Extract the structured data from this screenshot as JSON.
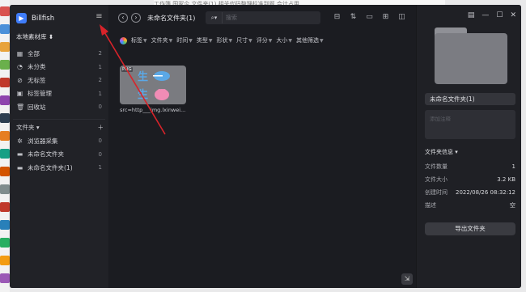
{
  "outer": {
    "top_text": "工作簿  国家企  文件夹(1)  相关代码整理标准到题  合计占用",
    "thumb_colors": [
      "#d9534f",
      "#4a90d9",
      "#e8a33c",
      "#6ab04c",
      "#c0392b",
      "#8e44ad",
      "#2c3e50",
      "#e67e22",
      "#16a085",
      "#d35400",
      "#7f8c8d",
      "#c0392b",
      "#2980b9",
      "#27ae60",
      "#f39c12",
      "#9b59b6"
    ]
  },
  "app": {
    "brand": "Billfish",
    "library": "本地素材库",
    "nav": [
      {
        "icon": "grid-icon",
        "glyph": "▦",
        "label": "全部",
        "count": "2"
      },
      {
        "icon": "pie-icon",
        "glyph": "◔",
        "label": "未分类",
        "count": "1"
      },
      {
        "icon": "tag-off-icon",
        "glyph": "⊘",
        "label": "无标签",
        "count": "2"
      },
      {
        "icon": "tag-manage-icon",
        "glyph": "▣",
        "label": "标签管理",
        "count": "1"
      },
      {
        "icon": "trash-icon",
        "glyph": "🗑",
        "label": "回收站",
        "count": "0"
      }
    ],
    "folders_header": "文件夹",
    "folders": [
      {
        "icon": "browser-collect-icon",
        "glyph": "✲",
        "label": "浏览器采集",
        "count": "0"
      },
      {
        "icon": "folder-icon",
        "glyph": "▬",
        "label": "未命名文件夹",
        "count": "0"
      },
      {
        "icon": "folder-icon",
        "glyph": "▬",
        "label": "未命名文件夹(1)",
        "count": "1"
      }
    ]
  },
  "main": {
    "breadcrumb": "未命名文件夹(1)",
    "search_placeholder": "搜索",
    "filters": [
      "标签",
      "文件夹",
      "时间",
      "类型",
      "形状",
      "尺寸",
      "评分",
      "大小",
      "其他筛选"
    ],
    "card": {
      "badge": "PNG",
      "glyph": "生",
      "caption": "src=http___img.lxinwei..."
    }
  },
  "panel": {
    "name": "未命名文件夹(1)",
    "note_placeholder": "添加注释",
    "info_header": "文件夹信息",
    "info": [
      {
        "k": "文件数量",
        "v": "1"
      },
      {
        "k": "文件大小",
        "v": "3.2 KB"
      },
      {
        "k": "创建时间",
        "v": "2022/08/26 08:32:12"
      },
      {
        "k": "描述",
        "v": "空"
      }
    ],
    "export_label": "导出文件夹"
  },
  "colors": {
    "accent": "#3f7dfb",
    "arrow": "#d9232a"
  }
}
